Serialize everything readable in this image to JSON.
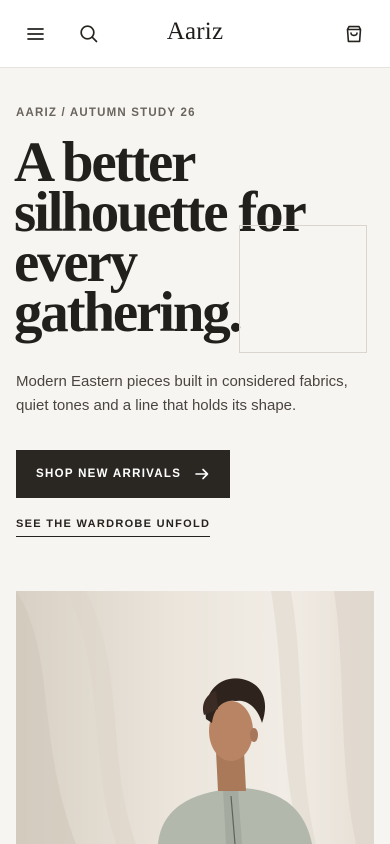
{
  "header": {
    "brand": "Aariz",
    "menu_icon": "menu-icon",
    "search_icon": "search-icon",
    "cart_icon": "shopping-bag-icon"
  },
  "hero": {
    "eyebrow": "AARIZ / AUTUMN STUDY 26",
    "headline_lines": [
      "A better",
      "silhouette for",
      "every",
      "gathering."
    ],
    "description": "Modern Eastern pieces built in considered fabrics, quiet tones and a line that holds its shape.",
    "primary_cta": "SHOP NEW ARRIVALS",
    "primary_cta_icon": "arrow-right-icon",
    "secondary_link": "SEE THE WARDROBE UNFOLD"
  },
  "colors": {
    "page_background": "#f7f5f1",
    "header_background": "#ffffff",
    "ink": "#26231f",
    "button_background": "#2a2622",
    "button_text": "#ffffff"
  }
}
